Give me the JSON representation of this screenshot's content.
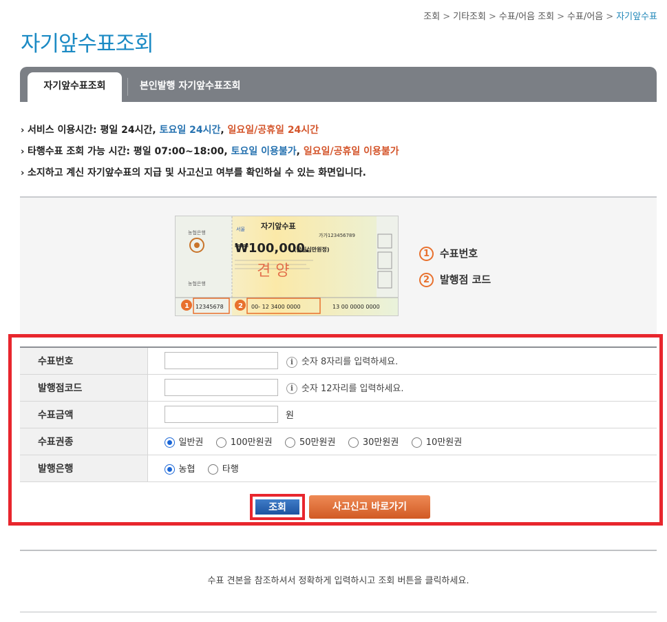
{
  "breadcrumb": {
    "items": [
      "조회",
      "기타조회",
      "수표/어음 조회",
      "수표/어음"
    ],
    "current": "자기앞수표"
  },
  "page_title": "자기앞수표조회",
  "tabs": [
    {
      "label": "자기앞수표조회",
      "active": true
    },
    {
      "label": "본인발행 자기앞수표조회",
      "active": false
    }
  ],
  "notices": {
    "line1": {
      "prefix": "서비스 이용시간: 평일 24시간, ",
      "sat": "토요일 24시간",
      "comma": ", ",
      "hol": "일요일/공휴일 24시간"
    },
    "line2": {
      "prefix": "타행수표 조회 가능 시간: 평일 07:00~18:00, ",
      "sat": "토요일 이용불가",
      "comma": ", ",
      "hol": "일요일/공휴일 이용불가"
    },
    "line3": "소지하고 계신 자기앞수표의 지급 및 사고신고 여부를 확인하실 수 있는 화면입니다."
  },
  "sample_check": {
    "title": "자기앞수표",
    "bank": "농협은행",
    "city": "서울",
    "amount": "₩100,000.",
    "amount_text": "(금일십만원정)",
    "serial_top": "가가123456789",
    "stamp": "견 양",
    "field1": "12345678",
    "field2": "00- 12 3400 0000",
    "field3": "13 00 0000 0000",
    "badge1": "1",
    "badge2": "2"
  },
  "legend": [
    {
      "num": "1",
      "label": "수표번호"
    },
    {
      "num": "2",
      "label": "발행점 코드"
    }
  ],
  "form": {
    "check_number": {
      "label": "수표번호",
      "value": "",
      "hint": "숫자 8자리를 입력하세요."
    },
    "branch_code": {
      "label": "발행점코드",
      "value": "",
      "hint": "숫자 12자리를 입력하세요."
    },
    "amount": {
      "label": "수표금액",
      "value": "",
      "unit": "원"
    },
    "check_type": {
      "label": "수표권종",
      "options": [
        "일반권",
        "100만원권",
        "50만원권",
        "30만원권",
        "10만원권"
      ],
      "selected": "일반권"
    },
    "issuing_bank": {
      "label": "발행은행",
      "options": [
        "농협",
        "타행"
      ],
      "selected": "농협"
    }
  },
  "buttons": {
    "search": "조회",
    "report": "사고신고 바로가기"
  },
  "bottom_note": "수표 견본을 참조하셔서 정확하게 입력하시고 조회 버튼을 클릭하세요.",
  "colors": {
    "title_blue": "#1b8ac4",
    "highlight_red": "#e8262d",
    "accent_orange": "#e8702d",
    "radio_blue": "#1a66d6"
  }
}
